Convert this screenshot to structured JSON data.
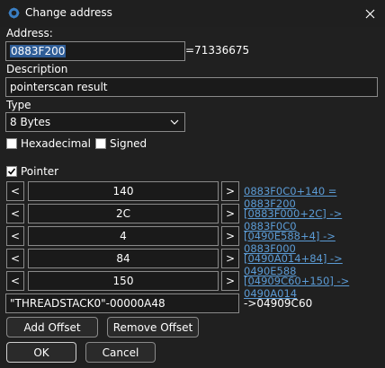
{
  "window": {
    "title": "Change address",
    "close_icon": "close-icon",
    "app_icon": "cheat-engine-gear-icon"
  },
  "address": {
    "label": "Address:",
    "value": "0883F200",
    "equals": "=71336675"
  },
  "description": {
    "label": "Description",
    "value": "pointerscan result"
  },
  "type": {
    "label": "Type",
    "value": "8 Bytes"
  },
  "options": {
    "hexadecimal": "Hexadecimal",
    "signed": "Signed",
    "hexadecimal_checked": false,
    "signed_checked": false
  },
  "pointer": {
    "label": "Pointer",
    "checked": true,
    "offsets": [
      {
        "left": "<",
        "value": "140",
        "right": ">",
        "result": "0883F0C0+140 = 0883F200"
      },
      {
        "left": "<",
        "value": "2C",
        "right": ">",
        "result": "[0883F000+2C] -> 0883F0C0"
      },
      {
        "left": "<",
        "value": "4",
        "right": ">",
        "result": "[0490E588+4] -> 0883F000"
      },
      {
        "left": "<",
        "value": "84",
        "right": ">",
        "result": "[0490A014+84] -> 0490E588"
      },
      {
        "left": "<",
        "value": "150",
        "right": ">",
        "result": "[04909C60+150] -> 0490A014"
      }
    ],
    "base": {
      "value": "\"THREADSTACK0\"-00000A48",
      "result": "->04909C60"
    }
  },
  "buttons": {
    "add_offset": "Add Offset",
    "remove_offset": "Remove Offset",
    "ok": "OK",
    "cancel": "Cancel"
  }
}
